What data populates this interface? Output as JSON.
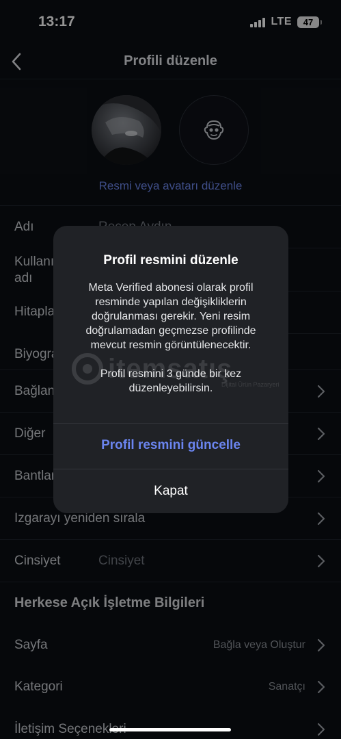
{
  "status_bar": {
    "time": "13:17",
    "network": "LTE",
    "battery": "47"
  },
  "nav": {
    "title": "Profili düzenle",
    "back_icon": "chevron-left-icon"
  },
  "profile": {
    "edit_link": "Resmi veya avatarı düzenle",
    "photo_icon": "profile-photo",
    "avatar_icon": "avatar-face-icon"
  },
  "rows": [
    {
      "label": "Adı",
      "value": "Recep Aydın"
    },
    {
      "label": "Kullanıcı adı",
      "value": ""
    },
    {
      "label": "Hitaplar",
      "value": ""
    },
    {
      "label": "Biyografi",
      "value": ""
    },
    {
      "label": "Bağlantılar",
      "value": ""
    },
    {
      "label": "Diğer",
      "value": ""
    },
    {
      "label": "Bantlar",
      "value": ""
    },
    {
      "label": "Izgarayı yeniden sırala",
      "value": ""
    },
    {
      "label": "Cinsiyet",
      "value": "Cinsiyet"
    }
  ],
  "business": {
    "title": "Herkese Açık İşletme Bilgileri",
    "rows": [
      {
        "label": "Sayfa",
        "value": "Bağla veya Oluştur"
      },
      {
        "label": "Kategori",
        "value": "Sanatçı"
      },
      {
        "label": "İletişim Seçenekleri",
        "value": ""
      }
    ]
  },
  "dialog": {
    "title": "Profil resmini düzenle",
    "body_1": "Meta Verified abonesi olarak profil resminde yapılan değişikliklerin doğrulanması gerekir. Yeni resim doğrulamadan geçmezse profilinde mevcut resmin görüntülenecektir.",
    "body_2": "Profil resmini 3 günde bir kez düzenleyebilirsin.",
    "primary_button": "Profil resmini güncelle",
    "close_button": "Kapat"
  },
  "watermark": {
    "text": "itemsatış",
    "sub": "Dijital Ürün Pazaryeri"
  },
  "colors": {
    "accent": "#6b85f0",
    "background": "#0c0f14",
    "dialog": "#202226"
  }
}
